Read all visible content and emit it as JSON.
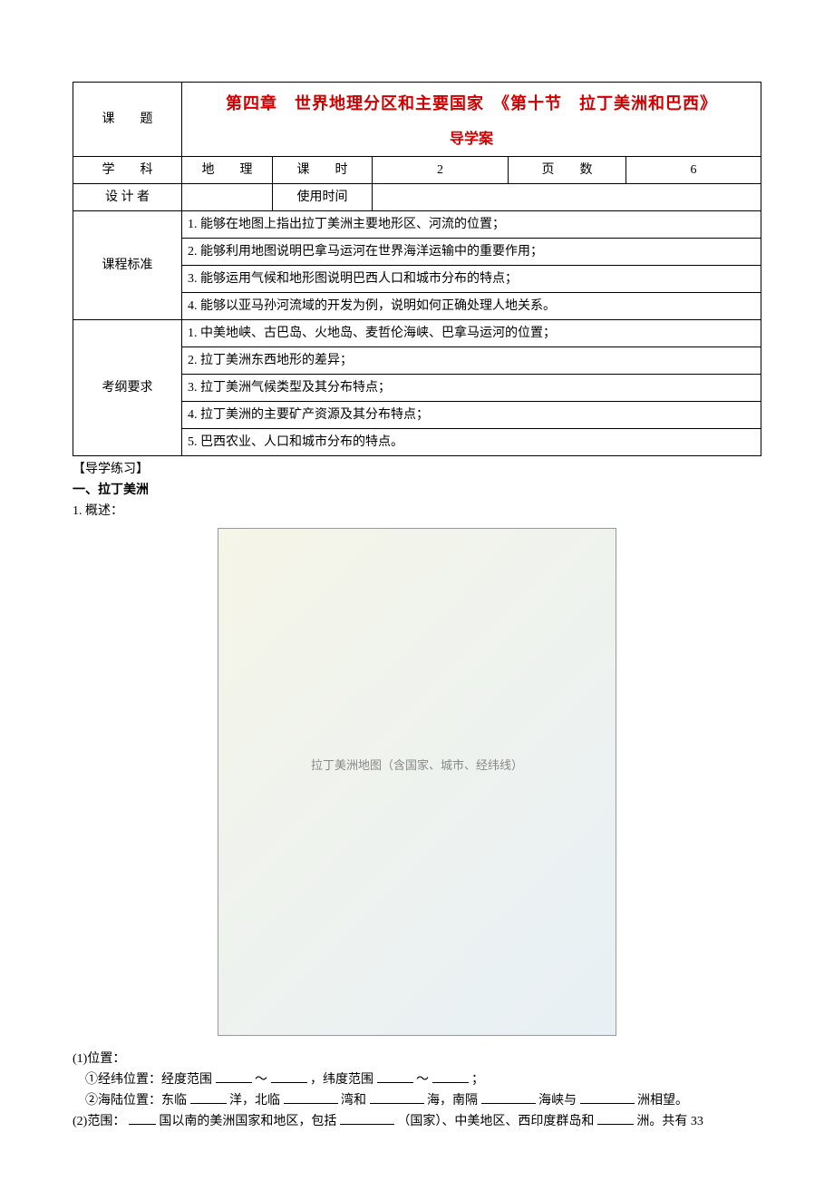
{
  "header": {
    "topic_label": "课　　题",
    "title_line1": "第四章　世界地理分区和主要国家　《第十节　拉丁美洲和巴西》",
    "title_line2": "导学案",
    "subject_label": "学　　科",
    "subject_value": "地　　理",
    "periods_label": "课　　时",
    "periods_value": "2",
    "pages_label": "页　　数",
    "pages_value": "6",
    "designer_label": "设 计 者",
    "designer_value": "",
    "use_time_label": "使用时间",
    "use_time_value": ""
  },
  "standards": {
    "label": "课程标准",
    "items": [
      "1. 能够在地图上指出拉丁美洲主要地形区、河流的位置；",
      "2. 能够利用地图说明巴拿马运河在世界海洋运输中的重要作用；",
      "3. 能够运用气候和地形图说明巴西人口和城市分布的特点；",
      "4. 能够以亚马孙河流域的开发为例，说明如何正确处理人地关系。"
    ]
  },
  "exam": {
    "label": "考纲要求",
    "items": [
      "1. 中美地峡、古巴岛、火地岛、麦哲伦海峡、巴拿马运河的位置；",
      "2. 拉丁美洲东西地形的差异；",
      "3. 拉丁美洲气候类型及其分布特点；",
      "4. 拉丁美洲的主要矿产资源及其分布特点；",
      "5. 巴西农业、人口和城市分布的特点。"
    ]
  },
  "body": {
    "practice_head": "【导学练习】",
    "section1_head": "一、拉丁美洲",
    "item1": "1. 概述：",
    "map_caption": "拉丁美洲地图（含国家、城市、经纬线）",
    "pos_head": "(1)位置：",
    "pos_line1_a": "①经纬位置：经度范围",
    "pos_line1_b": "，纬度范围",
    "pos_line1_sep": "～",
    "pos_line1_end": "；",
    "pos_line2_a": "②海陆位置：东临",
    "pos_line2_b": "洋，北临",
    "pos_line2_c": "湾和",
    "pos_line2_d": "海，南隔",
    "pos_line2_e": "海峡与",
    "pos_line2_f": "洲相望。",
    "range_a": "(2)范围：",
    "range_b": "国以南的美洲国家和地区，包括",
    "range_c": "（国家）、中美地区、西印度群岛和",
    "range_d": "洲。共有 33"
  }
}
